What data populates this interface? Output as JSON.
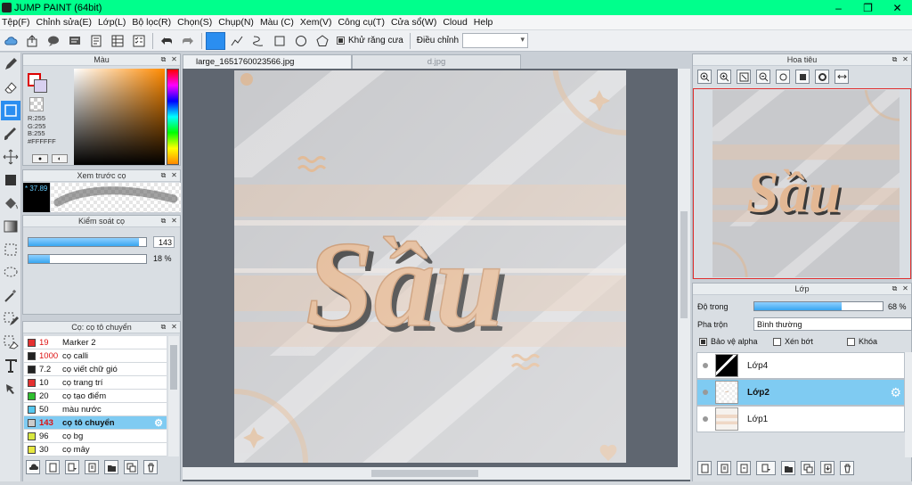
{
  "window": {
    "title": "JUMP PAINT (64bit)",
    "controls": [
      "–",
      "❐",
      "✕"
    ]
  },
  "menu": [
    "Tệp(F)",
    "Chỉnh sửa(E)",
    "Lớp(L)",
    "Bộ lọc(R)",
    "Chọn(S)",
    "Chụp(N)",
    "Màu (C)",
    "Xem(V)",
    "Công cụ(T)",
    "Cửa sổ(W)",
    "Cloud",
    "Help"
  ],
  "toolbar": {
    "antialias_label": "Khử răng cưa",
    "adjust_label": "Điều chỉnh",
    "adjust_value": ""
  },
  "color_panel": {
    "title": "Màu",
    "rgb": [
      "R:255",
      "G:255",
      "B:255"
    ],
    "hex": "#FFFFFF"
  },
  "brush_preview": {
    "title": "Xem trước cọ",
    "size": "* 37.89"
  },
  "brush_control": {
    "title": "Kiểm soát cọ",
    "size_value": "143",
    "size_fraction": 0.94,
    "opacity_value": "18 %",
    "opacity_fraction": 0.18
  },
  "brush_list": {
    "title": "Cọ: cọ tô chuyển",
    "items": [
      {
        "size": "19",
        "name": "Marker 2",
        "color": "#e53030",
        "size_red": true,
        "selected": false
      },
      {
        "size": "1000",
        "name": "cọ calli",
        "color": "#222222",
        "size_red": true,
        "selected": false
      },
      {
        "size": "7.2",
        "name": "cọ viết chữ gió",
        "color": "#222222",
        "size_red": false,
        "selected": false
      },
      {
        "size": "10",
        "name": "cọ trang trí",
        "color": "#e53030",
        "size_red": false,
        "selected": false
      },
      {
        "size": "20",
        "name": "cọ tạo điểm",
        "color": "#2fbf2f",
        "size_red": false,
        "selected": false
      },
      {
        "size": "50",
        "name": "màu nước",
        "color": "#55c8f0",
        "size_red": false,
        "selected": false
      },
      {
        "size": "143",
        "name": "cọ tô chuyển",
        "color": "#cccccc",
        "size_red": true,
        "selected": true
      },
      {
        "size": "96",
        "name": "cọ bg",
        "color": "#d8e840",
        "size_red": false,
        "selected": false
      },
      {
        "size": "30",
        "name": "cọ mây",
        "color": "#e8e840",
        "size_red": false,
        "selected": false
      }
    ]
  },
  "canvas": {
    "tabs": [
      "large_1651760023566.jpg",
      "d.jpg"
    ]
  },
  "navigator": {
    "title": "Hoa tiêu"
  },
  "layers": {
    "title": "Lớp",
    "opacity_label": "Độ trong",
    "opacity_value": "68 %",
    "opacity_fraction": 0.68,
    "blend_label": "Pha trộn",
    "blend_value": "Bình thường",
    "protect_alpha": "Bảo vệ alpha",
    "clipping": "Xén bớt",
    "lock": "Khóa",
    "list": [
      {
        "name": "Lớp4",
        "selected": false
      },
      {
        "name": "Lớp2",
        "selected": true
      },
      {
        "name": "Lớp1",
        "selected": false
      }
    ]
  },
  "artwork": {
    "word": "Sầu"
  }
}
